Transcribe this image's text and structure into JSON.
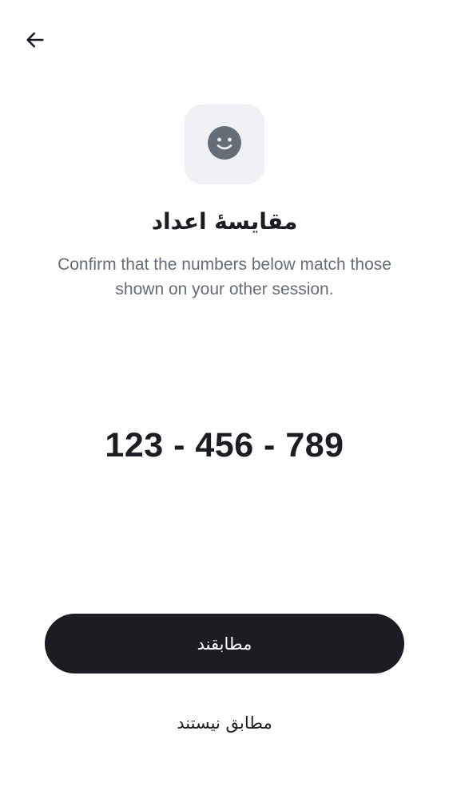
{
  "header": {
    "back_icon": "arrow-left-icon"
  },
  "hero": {
    "icon": "smiley-face-icon",
    "icon_bg_color": "#f0f1f5",
    "icon_color": "#656d77"
  },
  "title": "مقایسهٔ اعداد",
  "subtitle": "Confirm that the numbers below match those shown on your other session.",
  "numbers": "123 - 456 - 789",
  "actions": {
    "match_label": "مطابقند",
    "no_match_label": "مطابق نیستند",
    "primary_color": "#1b1d22"
  }
}
